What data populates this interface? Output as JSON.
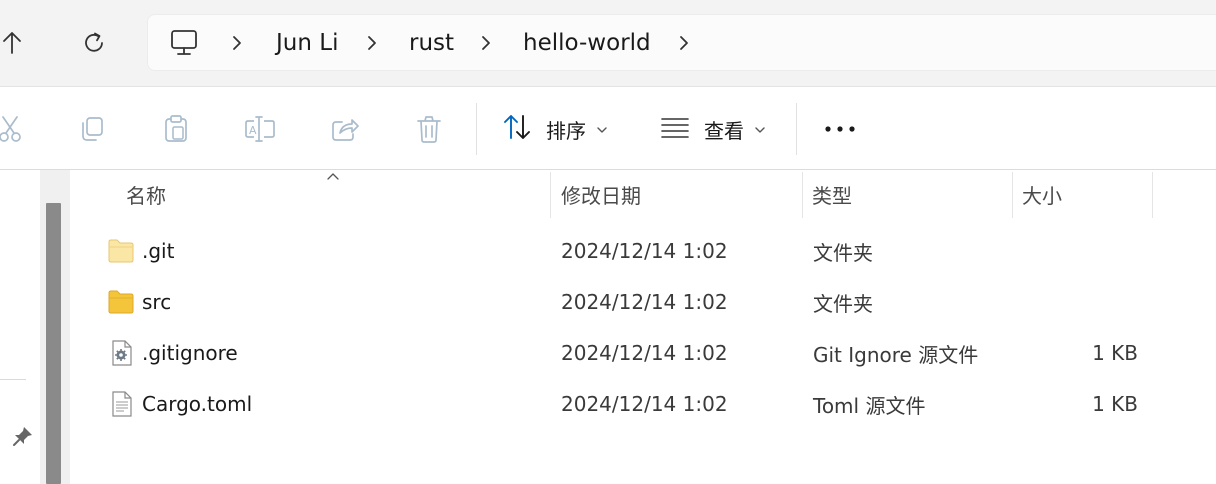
{
  "nav": {
    "up_icon": "arrow-up-icon",
    "refresh_icon": "refresh-icon"
  },
  "address": {
    "root_icon": "this-pc-icon",
    "crumbs": [
      "Jun Li",
      "rust",
      "hello-world"
    ]
  },
  "toolbar": {
    "cut_icon": "cut-icon",
    "copy_icon": "copy-icon",
    "paste_icon": "paste-icon",
    "rename_icon": "rename-icon",
    "share_icon": "share-icon",
    "delete_icon": "delete-icon",
    "sort_label": "排序",
    "view_label": "查看",
    "more_icon": "more-icon"
  },
  "columns": {
    "name": "名称",
    "date": "修改日期",
    "type": "类型",
    "size": "大小"
  },
  "files": [
    {
      "name": ".git",
      "date": "2024/12/14 1:02",
      "type": "文件夹",
      "size": "",
      "icon": "folder-icon"
    },
    {
      "name": "src",
      "date": "2024/12/14 1:02",
      "type": "文件夹",
      "size": "",
      "icon": "folder-icon"
    },
    {
      "name": ".gitignore",
      "date": "2024/12/14 1:02",
      "type": "Git Ignore 源文件",
      "size": "1 KB",
      "icon": "settings-file-icon"
    },
    {
      "name": "Cargo.toml",
      "date": "2024/12/14 1:02",
      "type": "Toml 源文件",
      "size": "1 KB",
      "icon": "text-file-icon"
    }
  ],
  "colors": {
    "accent": "#0067c0",
    "folder": "#f4c43a",
    "icon_disabled": "#a9bccc"
  }
}
